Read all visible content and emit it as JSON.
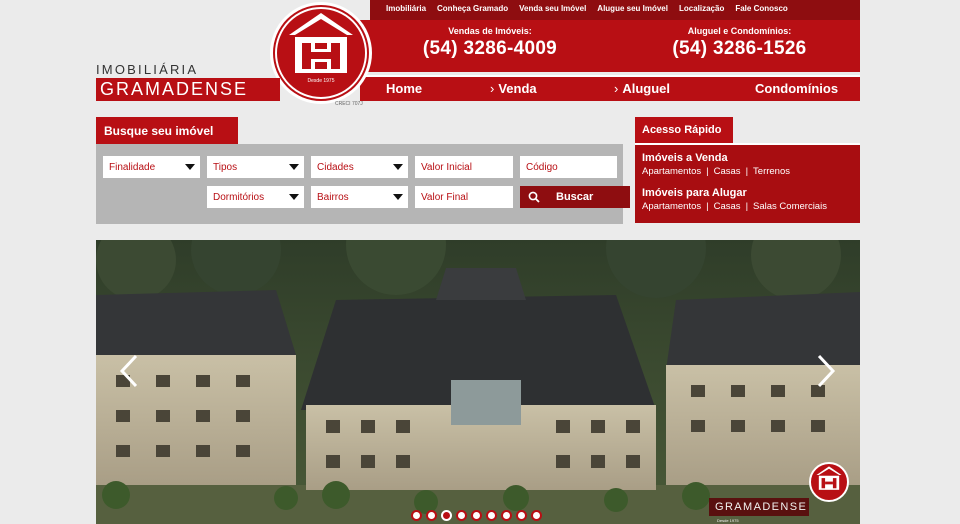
{
  "header": {
    "top_links": [
      "Imobiliária",
      "Conheça Gramado",
      "Venda seu Imóvel",
      "Alugue seu Imóvel",
      "Localização",
      "Fale Conosco"
    ],
    "sales_label": "Vendas de Imóveis:",
    "sales_phone": "(54) 3286-4009",
    "rent_label": "Aluguel e Condomínios:",
    "rent_phone": "(54) 3286-1526",
    "nav": [
      "Home",
      "Venda",
      "Aluguel",
      "Condomínios"
    ],
    "chevron": "›"
  },
  "brand": {
    "line1": "IMOBILIÁRIA",
    "line2": "GRAMADENSE",
    "since": "Desde 1975",
    "creci": "CRECI 707J"
  },
  "search": {
    "tab_label": "Busque seu imóvel",
    "selects": [
      "Finalidade",
      "Tipos",
      "Cidades",
      "Dormitórios",
      "Bairros"
    ],
    "inputs": [
      "Valor Inicial",
      "Código",
      "Valor Final"
    ],
    "button": "Buscar"
  },
  "quick_access": {
    "tab_label": "Acesso Rápido",
    "sale_title": "Imóveis a Venda",
    "sale_links": [
      "Apartamentos",
      "Casas",
      "Terrenos"
    ],
    "rent_title": "Imóveis para Alugar",
    "rent_links": [
      "Apartamentos",
      "Casas",
      "Salas Comerciais"
    ],
    "separator": "|"
  },
  "hero": {
    "watermark": "GRAMADENSE",
    "watermark_since": "Desde 1975",
    "slide_count": 9,
    "active_slide": 3
  },
  "colors": {
    "brand_red": "#b80f14",
    "dark_red": "#8e0d10",
    "panel_gray": "#b5b5b5"
  },
  "icons": [
    "logo-house-icon",
    "search-icon",
    "chevron-left-icon",
    "chevron-right-icon"
  ]
}
